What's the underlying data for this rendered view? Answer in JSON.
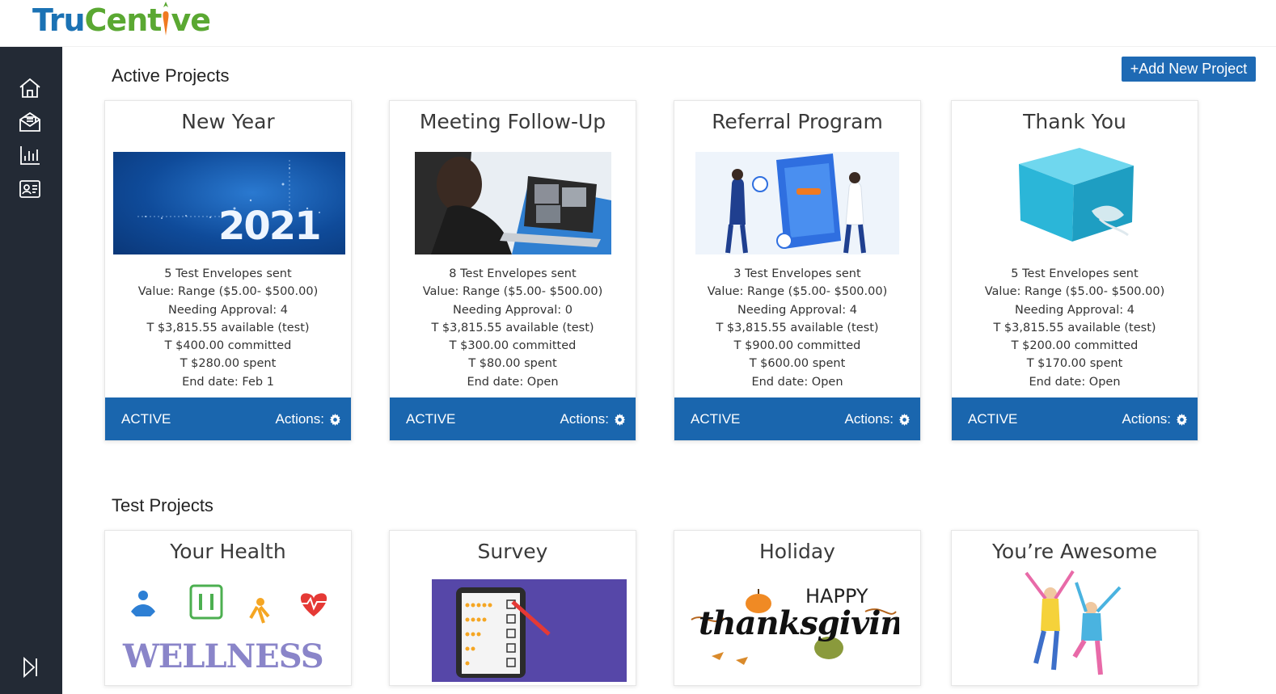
{
  "app": {
    "logo_text_part1": "Tru",
    "logo_text_part2": "Cent",
    "logo_text_part3": "ve"
  },
  "sidebar": {
    "items": [
      {
        "name": "home-icon"
      },
      {
        "name": "envelope-icon"
      },
      {
        "name": "chart-icon"
      },
      {
        "name": "contact-card-icon"
      }
    ],
    "collapse_icon": "sidebar-collapse-icon"
  },
  "active": {
    "title": "Active Projects",
    "add_button": "+Add New Project",
    "cards": [
      {
        "title": "New Year",
        "stats": [
          "5 Test Envelopes sent",
          "Value: Range ($5.00- $500.00)",
          "Needing Approval: 4",
          "T $3,815.55 available (test)",
          "T $400.00 committed",
          "T $280.00 spent",
          "End date: Feb 1"
        ],
        "status": "ACTIVE",
        "actions": "Actions:",
        "image_text": "2021"
      },
      {
        "title": "Meeting Follow-Up",
        "stats": [
          "8 Test Envelopes sent",
          "Value: Range ($5.00- $500.00)",
          "Needing Approval: 0",
          "T $3,815.55 available (test)",
          "T $300.00 committed",
          "T $80.00 spent",
          "End date: Open"
        ],
        "status": "ACTIVE",
        "actions": "Actions:"
      },
      {
        "title": "Referral Program",
        "stats": [
          "3 Test Envelopes sent",
          "Value: Range ($5.00- $500.00)",
          "Needing Approval: 4",
          "T $3,815.55 available (test)",
          "T $900.00 committed",
          "T $600.00 spent",
          "End date: Open"
        ],
        "status": "ACTIVE",
        "actions": "Actions:"
      },
      {
        "title": "Thank You",
        "stats": [
          "5 Test Envelopes sent",
          "Value: Range ($5.00- $500.00)",
          "Needing Approval: 4",
          "T $3,815.55 available (test)",
          "T $200.00 committed",
          "T $170.00 spent",
          "End date: Open"
        ],
        "status": "ACTIVE",
        "actions": "Actions:"
      }
    ]
  },
  "test": {
    "title": "Test Projects",
    "cards": [
      {
        "title": "Your Health",
        "image_text": "WELLNESS"
      },
      {
        "title": "Survey"
      },
      {
        "title": "Holiday",
        "image_text_1": "HAPPY",
        "image_text_2": "thanksgiving"
      },
      {
        "title": "You’re Awesome"
      }
    ]
  },
  "colors": {
    "brand_blue": "#1a66ae",
    "sidebar_bg": "#232a35",
    "logo_blue": "#1b72b4",
    "logo_green": "#5aa832"
  }
}
